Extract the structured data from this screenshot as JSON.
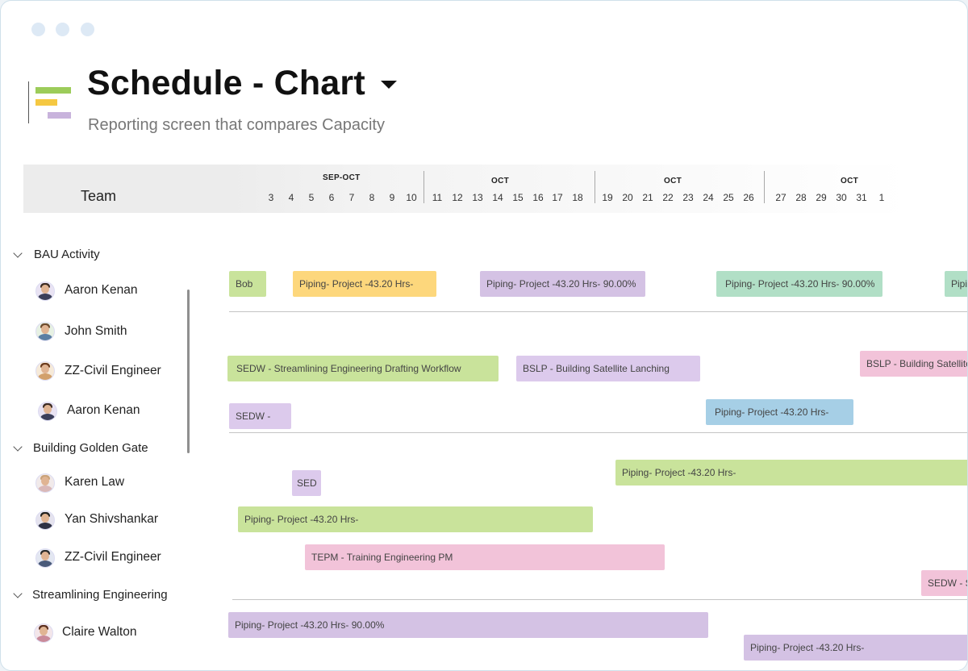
{
  "title": "Schedule - Chart",
  "subtitle": "Reporting screen that compares Capacity",
  "timeline": {
    "team_header": "Team",
    "months": [
      "SEP-OCT",
      "OCT",
      "OCT",
      "OCT"
    ],
    "days": [
      "3",
      "4",
      "5",
      "6",
      "7",
      "8",
      "9",
      "10",
      "11",
      "12",
      "13",
      "14",
      "15",
      "16",
      "17",
      "18",
      "19",
      "20",
      "21",
      "22",
      "23",
      "24",
      "25",
      "26",
      "27",
      "28",
      "29",
      "30",
      "31",
      "1"
    ]
  },
  "groups": [
    {
      "label": "BAU Activity"
    },
    {
      "label": "Building Golden Gate"
    },
    {
      "label": "Streamlining Engineering"
    }
  ],
  "people": [
    {
      "name": "Aaron Kenan"
    },
    {
      "name": "John Smith"
    },
    {
      "name": "ZZ-Civil Engineer"
    },
    {
      "name": "Aaron Kenan"
    },
    {
      "name": "Karen Law"
    },
    {
      "name": "Yan Shivshankar"
    },
    {
      "name": "ZZ-Civil Engineer"
    },
    {
      "name": "Claire Walton"
    }
  ],
  "bars": [
    {
      "label": "Bob",
      "color": "#c9e39b"
    },
    {
      "label": "Piping- Project -43.20 Hrs-",
      "color": "#fdd77c"
    },
    {
      "label": "Piping- Project -43.20 Hrs- 90.00%",
      "color": "#d4c2e4"
    },
    {
      "label": "Piping- Project -43.20 Hrs- 90.00%",
      "color": "#b1dfc6"
    },
    {
      "label": "Pipi",
      "color": "#b1dfc6"
    },
    {
      "label": "SEDW - Streamlining Engineering Drafting Workflow",
      "color": "#c9e39b"
    },
    {
      "label": "BSLP - Building Satellite Lanching",
      "color": "#dccaec"
    },
    {
      "label": "BSLP - Building Satellite",
      "color": "#f2c3d9"
    },
    {
      "label": "SEDW -",
      "color": "#dccaec"
    },
    {
      "label": "Piping- Project -43.20 Hrs-",
      "color": "#a6cfe6"
    },
    {
      "label": "Piping- Project -43.20 Hrs-",
      "color": "#c9e39b"
    },
    {
      "label": "SED",
      "color": "#dccaec"
    },
    {
      "label": "Piping- Project -43.20 Hrs-",
      "color": "#c9e39b"
    },
    {
      "label": "TEPM - Training Engineering PM",
      "color": "#f2c3d9"
    },
    {
      "label": "SEDW - St",
      "color": "#f2c3d9"
    },
    {
      "label": "Piping- Project -43.20 Hrs- 90.00%",
      "color": "#d4c2e4"
    },
    {
      "label": "Piping- Project -43.20 Hrs-",
      "color": "#d4c2e4"
    }
  ],
  "colors": {
    "accent_green": "#9ccc5a",
    "accent_yellow": "#f5c842",
    "accent_purple": "#c8b3dc"
  }
}
